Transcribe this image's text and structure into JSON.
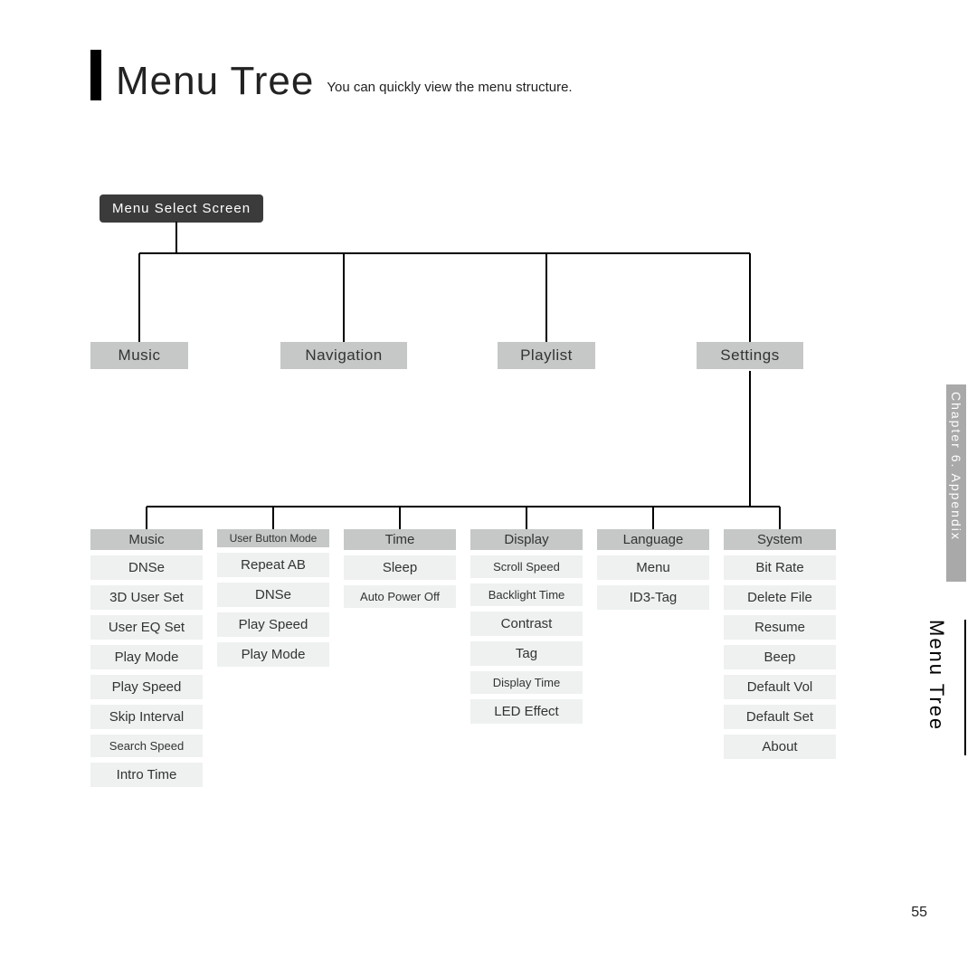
{
  "title": "Menu Tree",
  "subtitle": "You can quickly view the menu structure.",
  "side_tab": "Chapter 6. Appendix",
  "side_title": "Menu Tree",
  "page_number": "55",
  "root": "Menu Select Screen",
  "categories": [
    "Music",
    "Navigation",
    "Playlist",
    "Settings"
  ],
  "columns": [
    {
      "head": "Music",
      "items": [
        "DNSe",
        "3D User Set",
        "User EQ Set",
        "Play Mode",
        "Play Speed",
        "Skip Interval",
        "Search Speed",
        "Intro Time"
      ]
    },
    {
      "head": "User Button Mode",
      "items": [
        "Repeat AB",
        "DNSe",
        "Play Speed",
        "Play Mode"
      ]
    },
    {
      "head": "Time",
      "items": [
        "Sleep",
        "Auto Power Off"
      ]
    },
    {
      "head": "Display",
      "items": [
        "Scroll Speed",
        "Backlight Time",
        "Contrast",
        "Tag",
        "Display Time",
        "LED Effect"
      ]
    },
    {
      "head": "Language",
      "items": [
        "Menu",
        "ID3-Tag"
      ]
    },
    {
      "head": "System",
      "items": [
        "Bit Rate",
        "Delete File",
        "Resume",
        "Beep",
        "Default Vol",
        "Default Set",
        "About"
      ]
    }
  ]
}
